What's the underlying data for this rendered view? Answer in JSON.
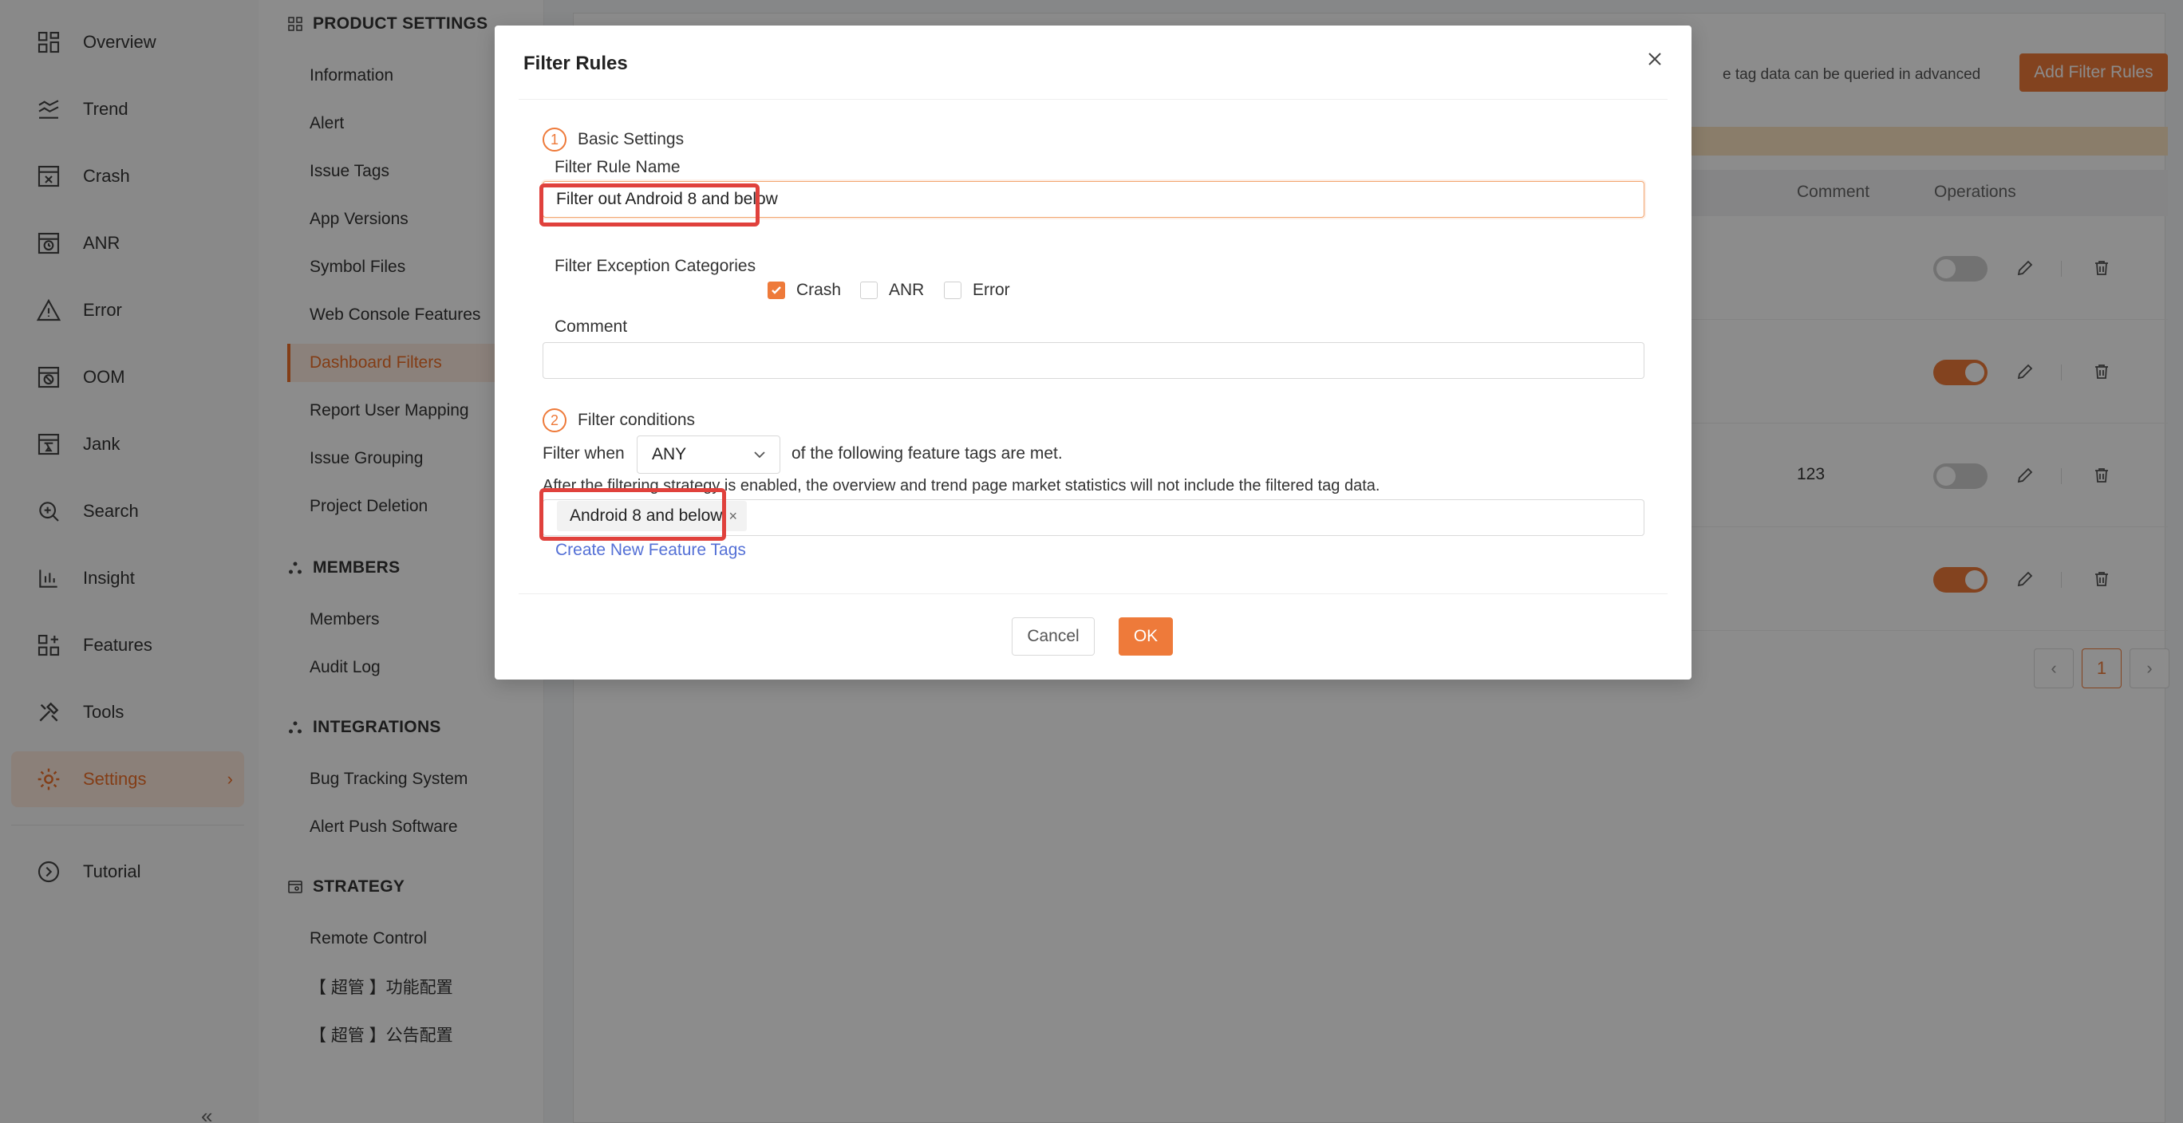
{
  "nav": {
    "items": [
      {
        "label": "Overview",
        "icon": "overview-icon"
      },
      {
        "label": "Trend",
        "icon": "trend-icon"
      },
      {
        "label": "Crash",
        "icon": "crash-icon"
      },
      {
        "label": "ANR",
        "icon": "anr-icon"
      },
      {
        "label": "Error",
        "icon": "error-icon"
      },
      {
        "label": "OOM",
        "icon": "oom-icon"
      },
      {
        "label": "Jank",
        "icon": "jank-icon"
      },
      {
        "label": "Search",
        "icon": "search-icon"
      },
      {
        "label": "Insight",
        "icon": "insight-icon"
      },
      {
        "label": "Features",
        "icon": "features-icon"
      },
      {
        "label": "Tools",
        "icon": "tools-icon"
      },
      {
        "label": "Settings",
        "icon": "settings-icon",
        "active": true
      },
      {
        "label": "Tutorial",
        "icon": "tutorial-icon"
      }
    ],
    "collapse_glyph": "«"
  },
  "subnav": {
    "product_settings": {
      "title": "PRODUCT SETTINGS",
      "items": [
        "Information",
        "Alert",
        "Issue Tags",
        "App Versions",
        "Symbol Files",
        "Web Console Features",
        "Dashboard Filters",
        "Report User Mapping",
        "Issue Grouping",
        "Project Deletion"
      ],
      "active": "Dashboard Filters"
    },
    "members": {
      "title": "MEMBERS",
      "items": [
        "Members",
        "Audit Log"
      ]
    },
    "integrations": {
      "title": "INTEGRATIONS",
      "items": [
        "Bug Tracking System",
        "Alert Push Software"
      ]
    },
    "strategy": {
      "title": "STRATEGY",
      "items": [
        "Remote Control",
        "【 超管 】功能配置",
        "【 超管 】公告配置"
      ]
    }
  },
  "main": {
    "description_fragment": "e tag data can be queried in advanced",
    "add_button": "Add Filter Rules",
    "table": {
      "headers": {
        "comment": "Comment",
        "operations": "Operations"
      },
      "rows": [
        {
          "comment": "",
          "enabled": false
        },
        {
          "comment": "",
          "enabled": true
        },
        {
          "comment": "123",
          "enabled": false
        },
        {
          "comment": "",
          "enabled": true
        }
      ]
    },
    "pagination": {
      "prev": "‹",
      "current": "1",
      "next": "›"
    }
  },
  "modal": {
    "title": "Filter Rules",
    "step1": {
      "number": "1",
      "title": "Basic Settings"
    },
    "rule_name_label": "Filter Rule Name",
    "rule_name_value": "Filter out Android 8 and below",
    "categories_label": "Filter Exception Categories",
    "categories": [
      {
        "label": "Crash",
        "checked": true
      },
      {
        "label": "ANR",
        "checked": false
      },
      {
        "label": "Error",
        "checked": false
      }
    ],
    "comment_label": "Comment",
    "comment_value": "",
    "step2": {
      "number": "2",
      "title": "Filter conditions"
    },
    "filter_when_label": "Filter when",
    "filter_when_value": "ANY",
    "filter_when_suffix": "of the following feature tags are met.",
    "notice": "After the filtering strategy is enabled, the overview and trend page market statistics will not include the filtered tag data.",
    "selected_tags": [
      "Android 8 and below"
    ],
    "tag_remove_glyph": "×",
    "create_link": "Create New Feature Tags",
    "cancel_label": "Cancel",
    "ok_label": "OK"
  },
  "colors": {
    "accent": "#ee7a3a",
    "highlight": "#e0413c",
    "link": "#5470d6"
  }
}
